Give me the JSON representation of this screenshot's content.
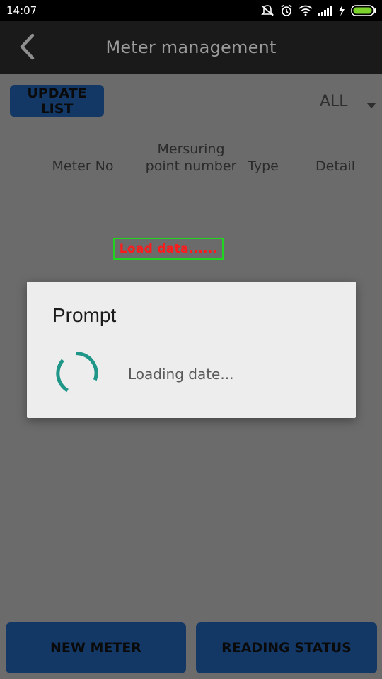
{
  "status_bar": {
    "time": "14:07",
    "icons": [
      "mute-icon",
      "alarm-icon",
      "wifi-icon",
      "signal-icon",
      "charging-icon",
      "battery-icon"
    ]
  },
  "app_bar": {
    "title": "Meter management",
    "back_icon": "chevron-left-icon"
  },
  "toolbar": {
    "update_label": "UPDATE LIST",
    "filter_value": "ALL"
  },
  "table": {
    "headers": {
      "meter_no": "Meter No",
      "measuring_point": "Mersuring point number",
      "type": "Type",
      "detail": "Detail"
    }
  },
  "loading_banner": "Load data......",
  "dialog": {
    "title": "Prompt",
    "message": "Loading date..."
  },
  "bottom_buttons": {
    "new_meter": "NEW METER",
    "reading_status": "READING STATUS"
  },
  "colors": {
    "button_bg": "#133866",
    "spinner": "#1e9688",
    "banner_text": "#ff1b1b",
    "banner_border": "#1fd51f"
  }
}
